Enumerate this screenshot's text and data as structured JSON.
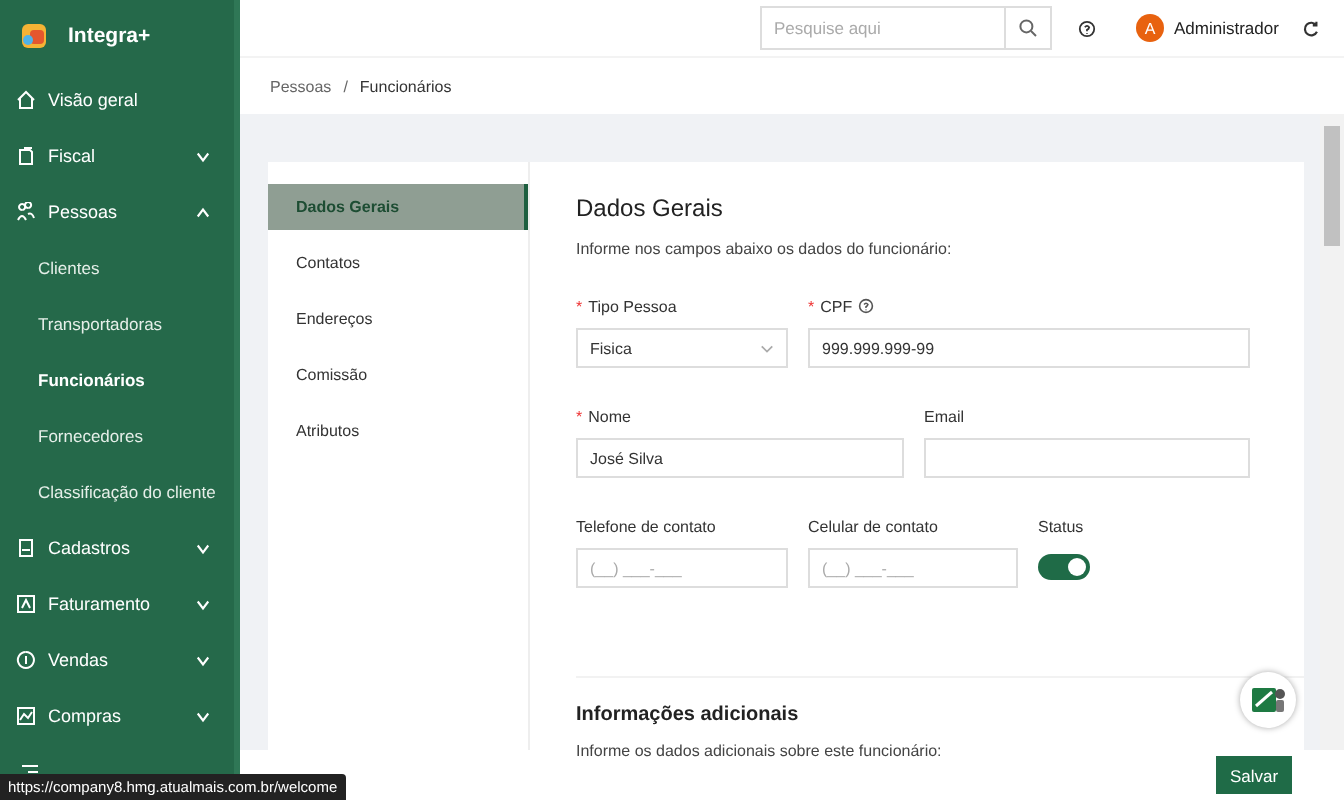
{
  "app": {
    "name": "Integra+"
  },
  "sidebar": {
    "items": [
      {
        "label": "Visão geral"
      },
      {
        "label": "Fiscal",
        "expanded": false
      },
      {
        "label": "Pessoas",
        "expanded": true,
        "children": [
          {
            "label": "Clientes",
            "selected": false
          },
          {
            "label": "Transportadoras",
            "selected": false
          },
          {
            "label": "Funcionários",
            "selected": true
          },
          {
            "label": "Fornecedores",
            "selected": false
          },
          {
            "label": "Classificação do cliente",
            "selected": false
          }
        ]
      },
      {
        "label": "Cadastros",
        "expanded": false
      },
      {
        "label": "Faturamento",
        "expanded": false
      },
      {
        "label": "Vendas",
        "expanded": false
      },
      {
        "label": "Compras",
        "expanded": false
      }
    ]
  },
  "header": {
    "search": {
      "placeholder": "Pesquise aqui"
    },
    "user": {
      "initial": "A",
      "name": "Administrador"
    }
  },
  "breadcrumb": [
    "Pessoas",
    "Funcionários"
  ],
  "breadcrumb_separator": "/",
  "required_mark": "*",
  "tabs": [
    {
      "label": "Dados Gerais",
      "selected": true
    },
    {
      "label": "Contatos",
      "selected": false
    },
    {
      "label": "Endereços",
      "selected": false
    },
    {
      "label": "Comissão",
      "selected": false
    },
    {
      "label": "Atributos",
      "selected": false
    }
  ],
  "form": {
    "title": "Dados Gerais",
    "description": "Informe nos campos abaixo os dados do funcionário:",
    "rows": [
      [
        {
          "kind": "select",
          "label": "Tipo Pessoa",
          "required": true,
          "value": "Fisica"
        },
        {
          "kind": "input",
          "label": "CPF",
          "required": true,
          "help": true,
          "value": "999.999.999-99"
        }
      ],
      [
        {
          "kind": "input",
          "label": "Nome",
          "required": true,
          "value": "José Silva"
        },
        {
          "kind": "input",
          "label": "Email",
          "required": false
        }
      ],
      [
        {
          "kind": "input",
          "label": "Telefone de contato",
          "required": false,
          "placeholder": "(__) ___-___"
        },
        {
          "kind": "input",
          "label": "Celular de contato",
          "required": false,
          "placeholder": "(__) ___-___"
        },
        {
          "kind": "toggle",
          "label": "Status",
          "on": true
        }
      ]
    ]
  },
  "additional": {
    "title": "Informações adicionais",
    "description": "Informe os dados adicionais sobre este funcionário:"
  },
  "save_button": "Salvar",
  "status_url": "https://company8.hmg.atualmais.com.br/welcome"
}
